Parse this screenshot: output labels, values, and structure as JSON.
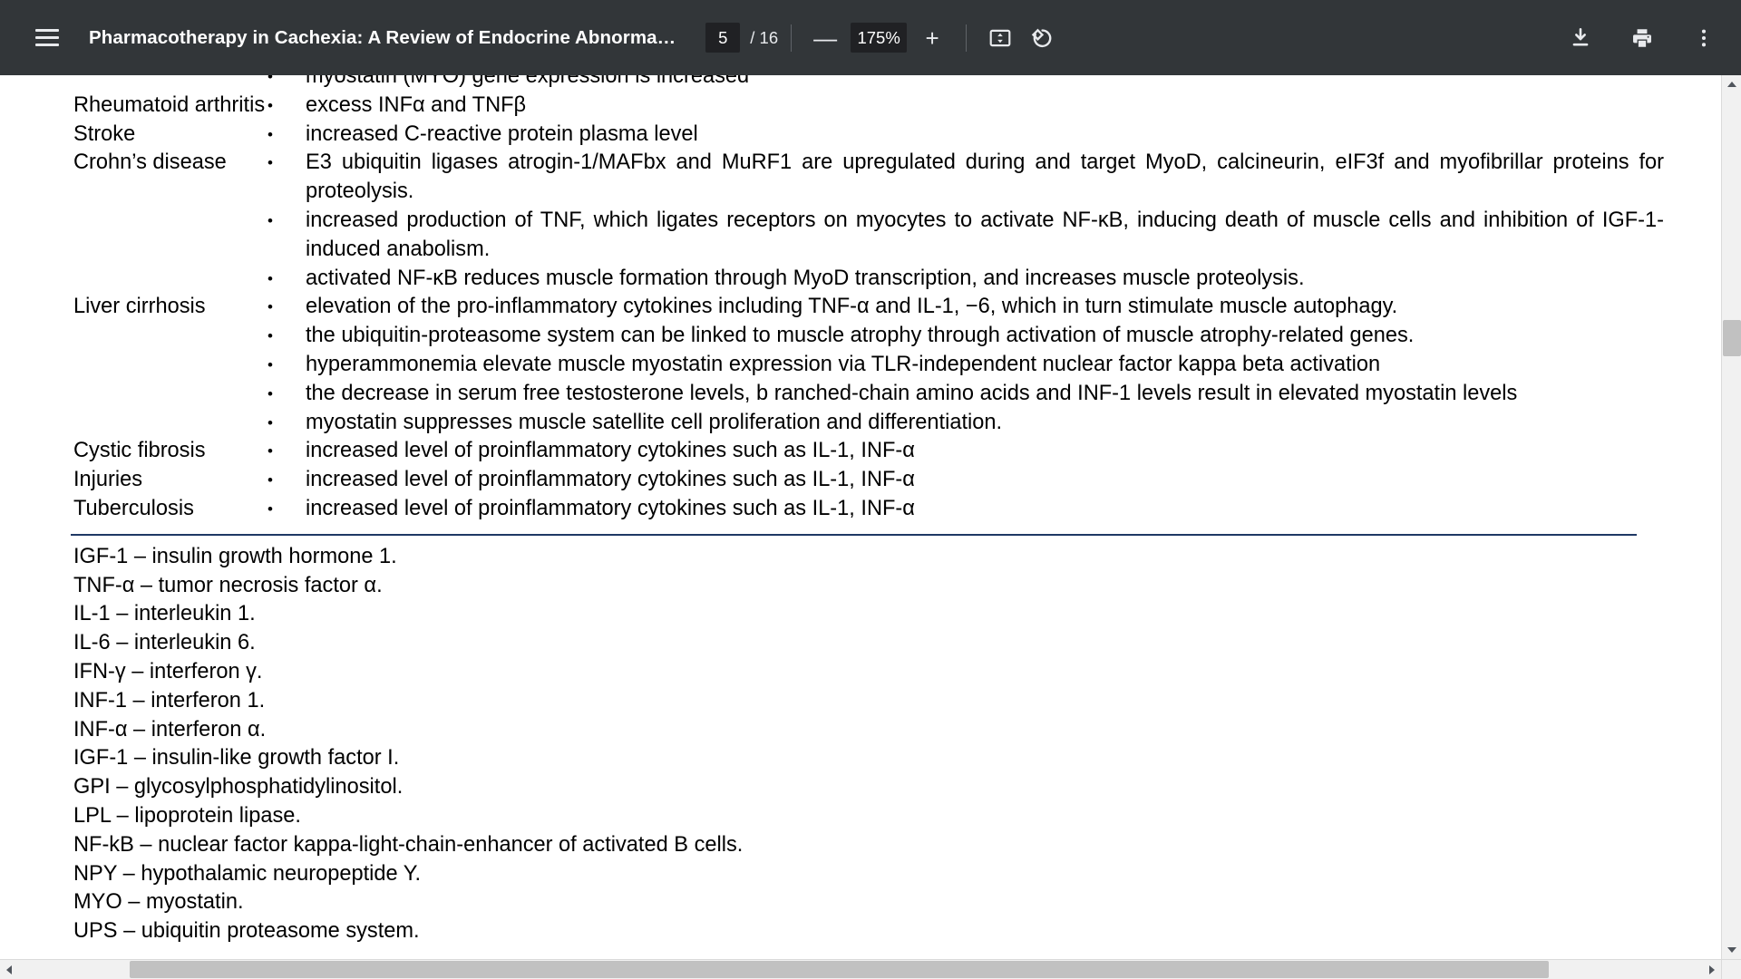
{
  "toolbar": {
    "menu_icon": "hamburger-menu-icon",
    "document_title": "Pharmacotherapy in Cachexia: A Review of Endocrine Abnorma…",
    "page_number": "5",
    "page_count": "/ 16",
    "zoom_out_label": "—",
    "zoom_level": "175%",
    "zoom_in_label": "+",
    "fit_icon": "fit-to-page-icon",
    "rotate_icon": "rotate-counterclockwise-icon",
    "download_icon": "download-icon",
    "print_icon": "print-icon",
    "more_icon": "more-vertical-icon",
    "background_color": "#323639",
    "input_background_color": "#202124"
  },
  "document": {
    "bullet_glyph": "•",
    "table_rule_color": "#1f3864",
    "table_rows": [
      {
        "condition": "",
        "bullets": [
          "myostatin (MYO) gene expression is increased"
        ]
      },
      {
        "condition": "Rheumatoid arthritis",
        "bullets": [
          "excess INFα and TNFβ"
        ]
      },
      {
        "condition": "Stroke",
        "bullets": [
          "increased C-reactive protein plasma level"
        ]
      },
      {
        "condition": "Crohn’s disease",
        "bullets": [
          "E3 ubiquitin ligases atrogin-1/MAFbx and MuRF1 are upregulated during and target MyoD, calcineurin, eIF3f and myofibrillar proteins for proteolysis.",
          "increased production of TNF, which ligates receptors on myocytes to activate NF-κB, inducing death of muscle cells and inhibition of IGF-1-induced anabolism.",
          "activated NF-κB reduces muscle formation through MyoD transcription, and increases muscle proteolysis."
        ]
      },
      {
        "condition": "Liver cirrhosis",
        "bullets": [
          "elevation of the pro-inflammatory cytokines including TNF-α and IL-1, −6, which in turn stimulate muscle autophagy.",
          "the ubiquitin-proteasome system can be linked to muscle atrophy through activation of muscle atrophy-related genes.",
          "hyperammonemia elevate muscle myostatin expression via TLR-independent nuclear factor kappa beta activation",
          "the decrease in serum free testosterone levels, b ranched-chain amino acids and INF-1 levels result in elevated myostatin levels",
          "myostatin suppresses muscle satellite cell proliferation and differentiation."
        ]
      },
      {
        "condition": "Cystic fibrosis",
        "bullets": [
          "increased level of proinflammatory cytokines such as IL-1, INF-α"
        ]
      },
      {
        "condition": "Injuries",
        "bullets": [
          "increased level of proinflammatory cytokines such as IL-1, INF-α"
        ]
      },
      {
        "condition": "Tuberculosis",
        "bullets": [
          "increased level of proinflammatory cytokines such as IL-1, INF-α"
        ]
      }
    ],
    "abbreviations": [
      "IGF-1 – insulin growth hormone 1.",
      "TNF-α – tumor necrosis factor α.",
      "IL-1 – interleukin 1.",
      "IL-6 – interleukin 6.",
      "IFN-γ – interferon γ.",
      "INF-1 – interferon 1.",
      "INF-α – interferon α.",
      "IGF-1 – insulin-like growth factor I.",
      "GPI – glycosylphosphatidylinositol.",
      "LPL – lipoprotein lipase.",
      "NF-kB – nuclear factor kappa-light-chain-enhancer of activated B cells.",
      "NPY – hypothalamic neuropeptide Y.",
      "MYO – myostatin.",
      "UPS – ubiquitin proteasome system."
    ]
  },
  "scrollbars": {
    "vertical_up_icon": "scroll-up-arrow-icon",
    "vertical_down_icon": "scroll-down-arrow-icon",
    "horizontal_left_icon": "scroll-left-arrow-icon",
    "horizontal_right_icon": "scroll-right-arrow-icon",
    "thumb_color": "#c1c1c1",
    "track_color": "#f1f1f1"
  }
}
